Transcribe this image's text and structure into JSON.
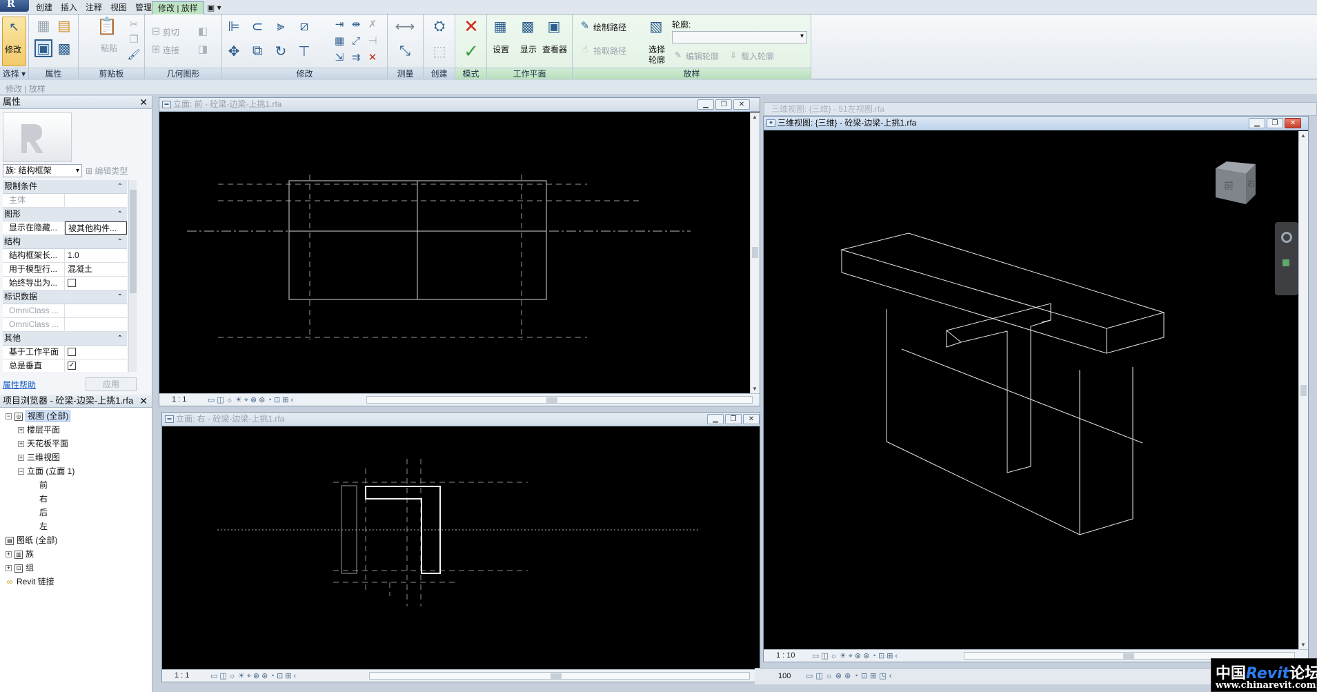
{
  "ribbon_tabs": [
    "创建",
    "插入",
    "注释",
    "视图",
    "管理",
    "修改 | 放样"
  ],
  "ribbon_tab_extra": "▣ ▾",
  "panels": {
    "select": {
      "label": "选择",
      "modify": "修改",
      "dropdown": "▾"
    },
    "properties": {
      "label": "属性"
    },
    "clipboard": {
      "label": "剪贴板",
      "paste": "粘贴"
    },
    "geometry": {
      "label": "几何图形",
      "cut": "剪切",
      "join": "连接"
    },
    "modify": {
      "label": "修改"
    },
    "measure": {
      "label": "测量"
    },
    "create": {
      "label": "创建"
    },
    "mode": {
      "label": "模式"
    },
    "workplane": {
      "label": "工作平面",
      "set": "设置",
      "show": "显示",
      "viewer": "查看器"
    },
    "sweep": {
      "label": "放样",
      "sketch_path": "绘制路径",
      "pick_path": "拾取路径",
      "select_profile": "选择\n轮廓",
      "select_profile_1": "选择",
      "select_profile_2": "轮廓",
      "profile_label": "轮廓:",
      "profile_value": "",
      "edit_profile": "编辑轮廓",
      "load_profile": "载入轮廓"
    }
  },
  "options_bar": "修改 | 放样",
  "properties": {
    "title": "属性",
    "type_selector": "族: 结构框架",
    "edit_type": "编辑类型",
    "categories": [
      {
        "name": "限制条件",
        "rows": [
          {
            "k": "主体",
            "v": "",
            "dim": true
          }
        ]
      },
      {
        "name": "图形",
        "rows": [
          {
            "k": "显示在隐藏...",
            "v": "被其他构件...",
            "sel": true
          }
        ]
      },
      {
        "name": "结构",
        "rows": [
          {
            "k": "结构框架长...",
            "v": "1.0"
          },
          {
            "k": "用于模型行...",
            "v": "混凝土"
          },
          {
            "k": "始终导出为...",
            "v": "",
            "check": false
          }
        ]
      },
      {
        "name": "标识数据",
        "rows": [
          {
            "k": "OmniClass ...",
            "v": "",
            "dim": true
          },
          {
            "k": "OmniClass ...",
            "v": "",
            "dim": true
          }
        ]
      },
      {
        "name": "其他",
        "rows": [
          {
            "k": "基于工作平面",
            "v": "",
            "check": false
          },
          {
            "k": "总是垂直",
            "v": "",
            "check": true
          }
        ]
      }
    ],
    "help": "属性帮助",
    "apply": "应用"
  },
  "browser": {
    "title": "项目浏览器 - 砼梁-边梁-上挑1.rfa",
    "items": [
      {
        "label": "视图 (全部)",
        "level": 0,
        "exp": "−",
        "icon": "views"
      },
      {
        "label": "楼层平面",
        "level": 1,
        "exp": "+"
      },
      {
        "label": "天花板平面",
        "level": 1,
        "exp": "+"
      },
      {
        "label": "三维视图",
        "level": 1,
        "exp": "+"
      },
      {
        "label": "立面 (立面 1)",
        "level": 1,
        "exp": "−"
      },
      {
        "label": "前",
        "level": 2
      },
      {
        "label": "右",
        "level": 2
      },
      {
        "label": "后",
        "level": 2
      },
      {
        "label": "左",
        "level": 2
      },
      {
        "label": "图纸 (全部)",
        "level": 0,
        "icon": "sheets"
      },
      {
        "label": "族",
        "level": 0,
        "exp": "+",
        "icon": "families"
      },
      {
        "label": "组",
        "level": 0,
        "exp": "+",
        "icon": "groups"
      },
      {
        "label": "Revit 链接",
        "level": 0,
        "icon": "links"
      }
    ]
  },
  "views": {
    "front": {
      "title": "立面: 前 - 砼梁-边梁-上挑1.rfa",
      "scale": "1 : 1"
    },
    "right": {
      "title": "立面: 右 - 砼梁-边梁-上挑1.rfa",
      "scale": "1 : 1"
    },
    "threed": {
      "title": "三维视图: {三维} - 砼梁-边梁-上挑1.rfa",
      "scale": "1 : 10"
    },
    "ghost": {
      "title": "三维视图: {三维} - 51左视图.rfa"
    }
  },
  "viewcube": {
    "face_front": "前",
    "face_right": "右"
  },
  "bottom_scale": "100",
  "watermark": {
    "line1_a": "中国",
    "line1_b": "Revit",
    "line1_c": "论坛",
    "line2": "www.chinarevit.com"
  },
  "colors": {
    "canvas": "#000000",
    "accent": "#2e5f8f",
    "context_tab": "#bfe4c4"
  }
}
